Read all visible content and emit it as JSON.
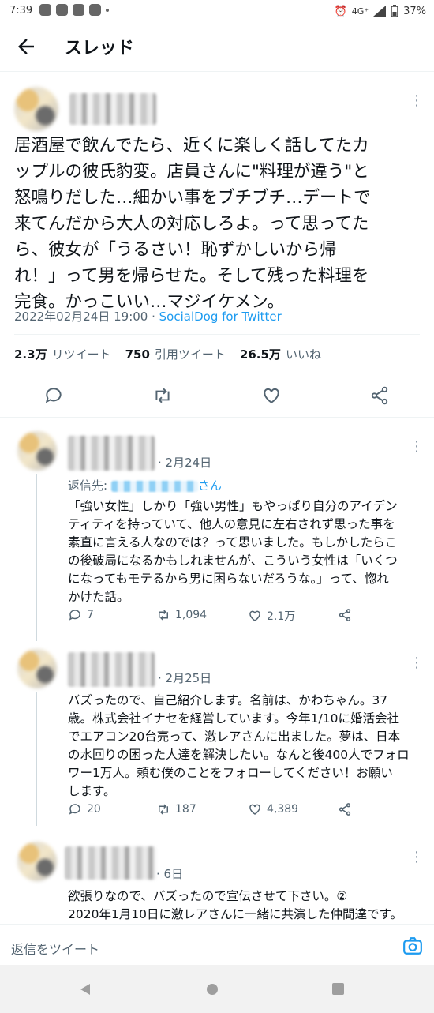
{
  "status_bar": {
    "time": "7:39",
    "network": "4G⁺",
    "battery": "37%"
  },
  "header": {
    "title": "スレッド"
  },
  "main_tweet": {
    "text_lines": [
      "居酒屋で飲んでたら、近くに楽しく話してたカ",
      "ップルの彼氏豹変。店員さんに\"料理が違う\"と",
      "怒鳴りだした…細かい事をブチブチ…デートで",
      "来てんだから大人の対応しろよ。って思ってた",
      "ら、彼女が「うるさい！恥ずかしいから帰",
      "れ！」って男を帰らせた。そして残った料理を",
      "完食。かっこいい…マジイケメン。"
    ],
    "timestamp": "2022年02月24日 19:00",
    "separator": " · ",
    "source": "SocialDog for Twitter",
    "retweets_count": "2.3万",
    "retweets_label": "リツイート",
    "quotes_count": "750",
    "quotes_label": "引用ツイート",
    "likes_count": "26.5万",
    "likes_label": "いいね"
  },
  "replies": [
    {
      "date": "· 2月24日",
      "reply_to_label": "返信先: ",
      "reply_to_suffix": "さん",
      "text_lines": [
        "「強い女性」しかり「強い男性」もやっぱり自分のアイデン",
        "ティティを持っていて、他人の意見に左右されず思った事を",
        "素直に言える人なのでは？って思いました。もしかしたらこ",
        "の後破局になるかもしれませんが、こういう女性は「いくつ",
        "になってもモテるから男に困らないだろうな。」って、惚れ",
        "かけた話。"
      ],
      "replies": "7",
      "retweets": "1,094",
      "likes": "2.1万"
    },
    {
      "date": "· 2月25日",
      "text_lines": [
        "バズったので、自己紹介します。名前は、かわちゃん。37",
        "歳。株式会社イナセを経営しています。今年1/10に婚活会社",
        "でエアコン20台売って、激レアさんに出ました。夢は、日本",
        "の水回りの困った人達を解決したい。なんと後400人でフォロ",
        "ワー1万人。頼む僕のことをフォローしてください！お願い",
        "します。"
      ],
      "replies": "20",
      "retweets": "187",
      "likes": "4,389"
    },
    {
      "date": "· 6日",
      "text_lines": [
        "欲張りなので、バズったので宣伝させて下さい。②",
        "2020年1月10日に激レアさんに一緒に共演した仲間達です。"
      ]
    }
  ],
  "composer": {
    "placeholder": "返信をツイート"
  },
  "colors": {
    "accent": "#1d9bf0",
    "muted": "#536471",
    "text": "#0f1419"
  }
}
